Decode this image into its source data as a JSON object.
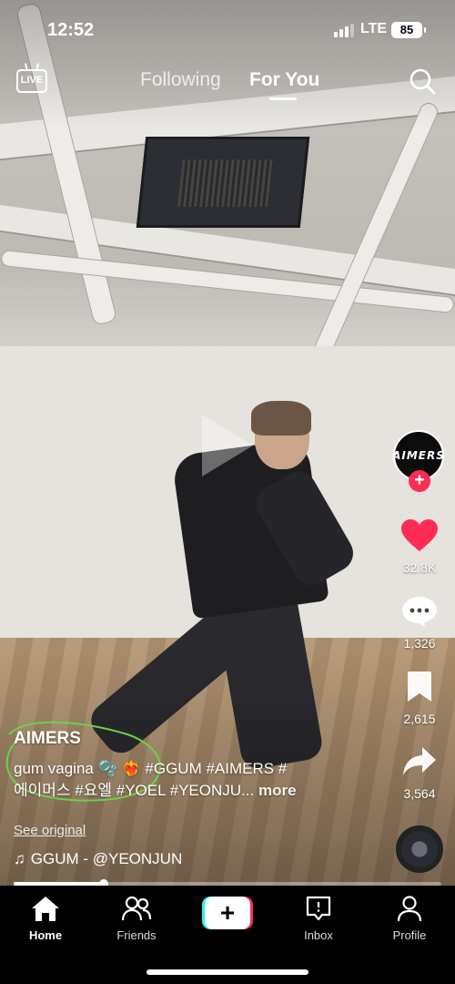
{
  "status_bar": {
    "time": "12:52",
    "network": "LTE",
    "battery": "85"
  },
  "top_nav": {
    "live_label": "LIVE",
    "tabs": [
      {
        "label": "Following",
        "active": false
      },
      {
        "label": "For You",
        "active": true
      }
    ],
    "search_icon": "search-icon"
  },
  "video": {
    "paused": true
  },
  "actions": {
    "creator_avatar_text": "AIMERS",
    "likes": "32.8K",
    "comments": "1,326",
    "saves": "2,615",
    "shares": "3,564",
    "like_color": "#fe2c55"
  },
  "caption": {
    "author": "AIMERS",
    "line1": "gum vagina 🫧 ❤️‍🔥 #GGUM #AIMERS #",
    "line2": "에이머스 #요엘 #YOEL #YEONJU...",
    "more_label": "more",
    "see_original": "See original",
    "music": "GGUM - @YEONJUN"
  },
  "progress": {
    "fraction": 0.21
  },
  "bottom_nav": {
    "items": [
      {
        "label": "Home",
        "icon": "home-icon",
        "active": true
      },
      {
        "label": "Friends",
        "icon": "friends-icon",
        "active": false
      },
      {
        "label": "",
        "icon": "create-plus-icon",
        "active": false
      },
      {
        "label": "Inbox",
        "icon": "inbox-icon",
        "active": false
      },
      {
        "label": "Profile",
        "icon": "profile-icon",
        "active": false
      }
    ]
  },
  "colors": {
    "accent_red": "#fe2c55",
    "accent_cyan": "#25f4ee",
    "annotation_green": "#6bd14a"
  }
}
